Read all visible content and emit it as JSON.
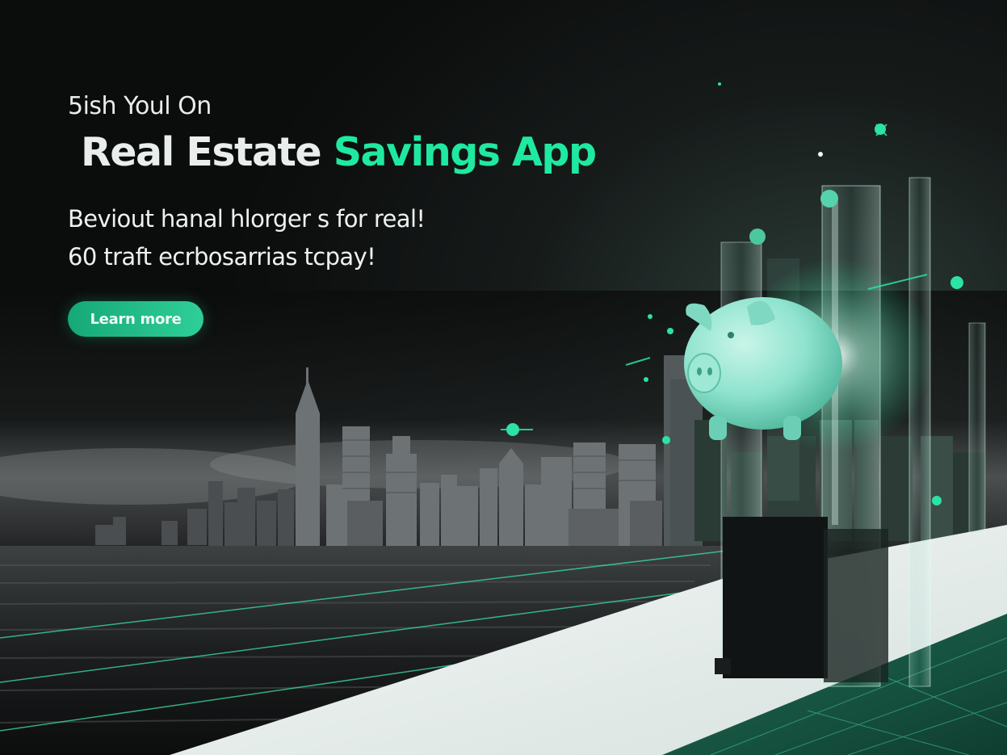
{
  "hero": {
    "eyebrow": "5ish Youl On",
    "title_part1": "Real Estate",
    "title_part2": "Savings App",
    "subtitle_line1": "Beviout hanal hlorger s for real!",
    "subtitle_line2": "60 traft ecrbosarrias tcpay!",
    "cta_label": "Learn more"
  },
  "colors": {
    "background": "#0d0f0f",
    "accent": "#1fe9a0",
    "title_white": "#e9eeec",
    "piggy": "#8fe3cf"
  },
  "icons": [
    "piggy-bank-icon",
    "city-skyline-illustration",
    "sparkle-icon"
  ]
}
